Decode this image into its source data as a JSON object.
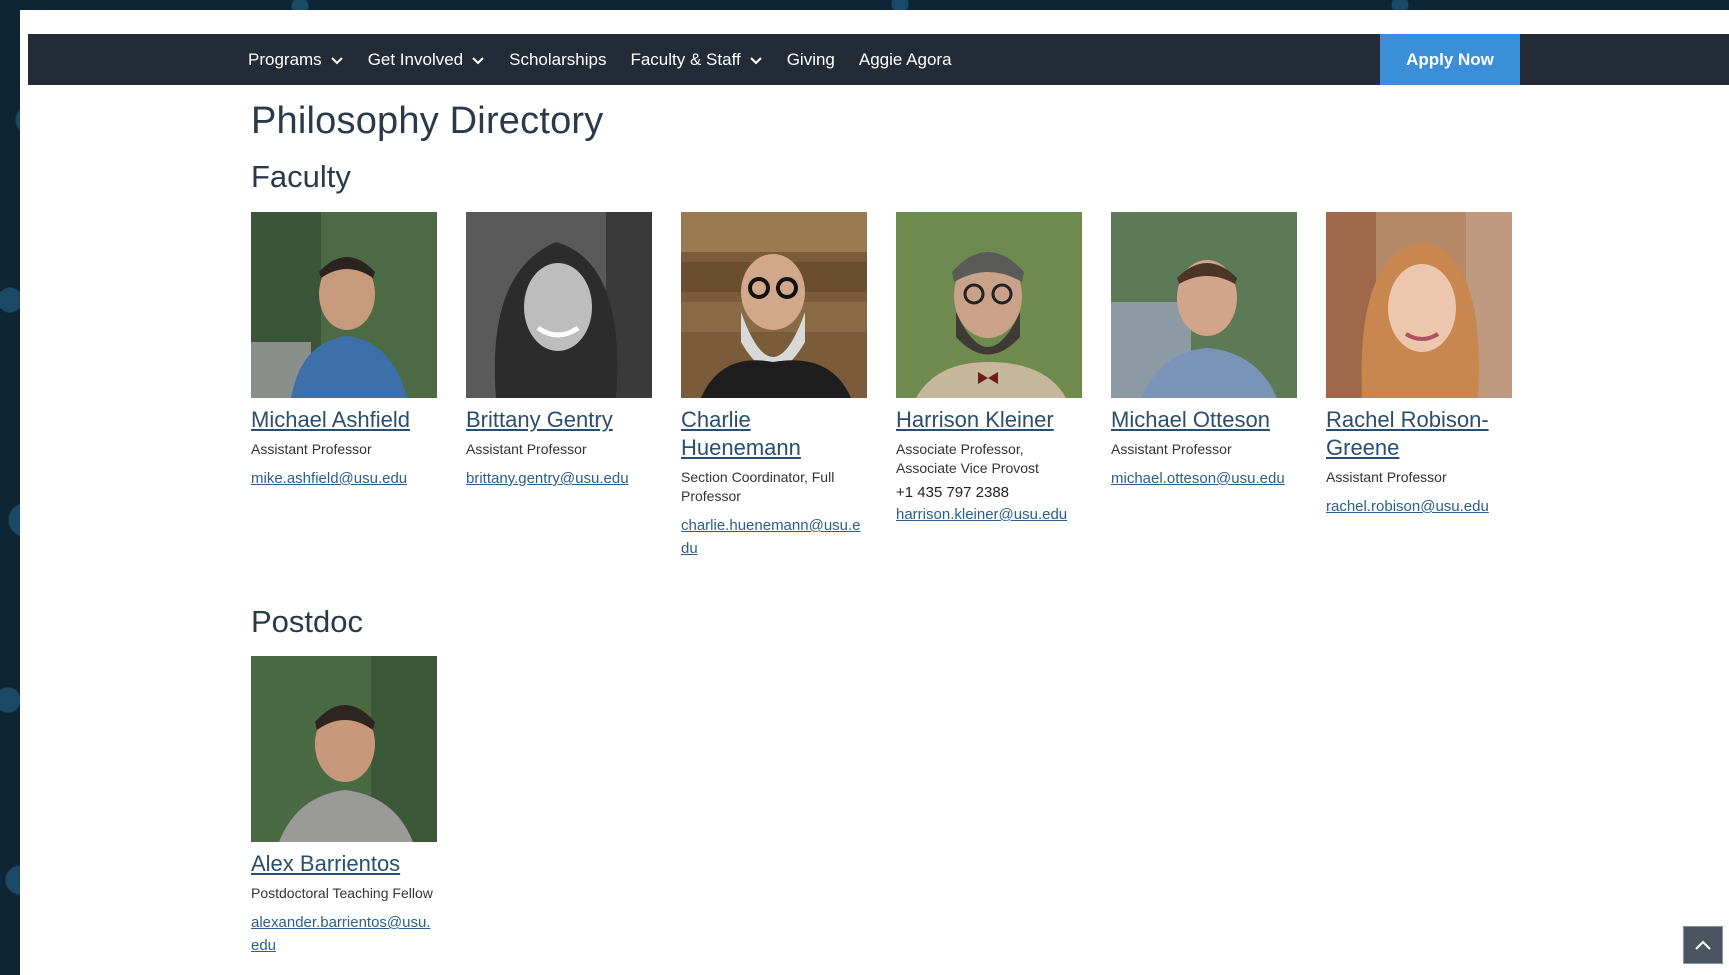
{
  "nav": {
    "items": [
      {
        "label": "Programs",
        "dropdown": true
      },
      {
        "label": "Get Involved",
        "dropdown": true
      },
      {
        "label": "Scholarships",
        "dropdown": false
      },
      {
        "label": "Faculty & Staff",
        "dropdown": true
      },
      {
        "label": "Giving",
        "dropdown": false
      },
      {
        "label": "Aggie Agora",
        "dropdown": false
      }
    ],
    "apply_label": "Apply Now"
  },
  "page": {
    "title": "Philosophy Directory",
    "faculty_heading": "Faculty",
    "postdoc_heading": "Postdoc"
  },
  "faculty": [
    {
      "name": "Michael Ashfield",
      "role": "Assistant Professor",
      "email": "mike.ashfield@usu.edu"
    },
    {
      "name": "Brittany Gentry",
      "role": "Assistant Professor",
      "email": "brittany.gentry@usu.edu"
    },
    {
      "name": "Charlie Huenemann",
      "role": "Section Coordinator, Full Professor",
      "email": "charlie.huenemann@usu.edu"
    },
    {
      "name": "Harrison Kleiner",
      "role": "Associate Professor, Associate Vice Provost",
      "phone": "+1 435 797 2388",
      "email": "harrison.kleiner@usu.edu"
    },
    {
      "name": "Michael Otteson",
      "role": "Assistant Professor",
      "email": "michael.otteson@usu.edu"
    },
    {
      "name": "Rachel Robison-Greene",
      "role": "Assistant Professor",
      "email": "rachel.robison@usu.edu"
    }
  ],
  "postdoc": [
    {
      "name": "Alex Barrientos",
      "role": "Postdoctoral Teaching Fellow",
      "email": "alexander.barrientos@usu.edu"
    }
  ],
  "colors": {
    "navbar": "#232b37",
    "apply": "#3b8fd9",
    "link": "#2b4e6e"
  }
}
